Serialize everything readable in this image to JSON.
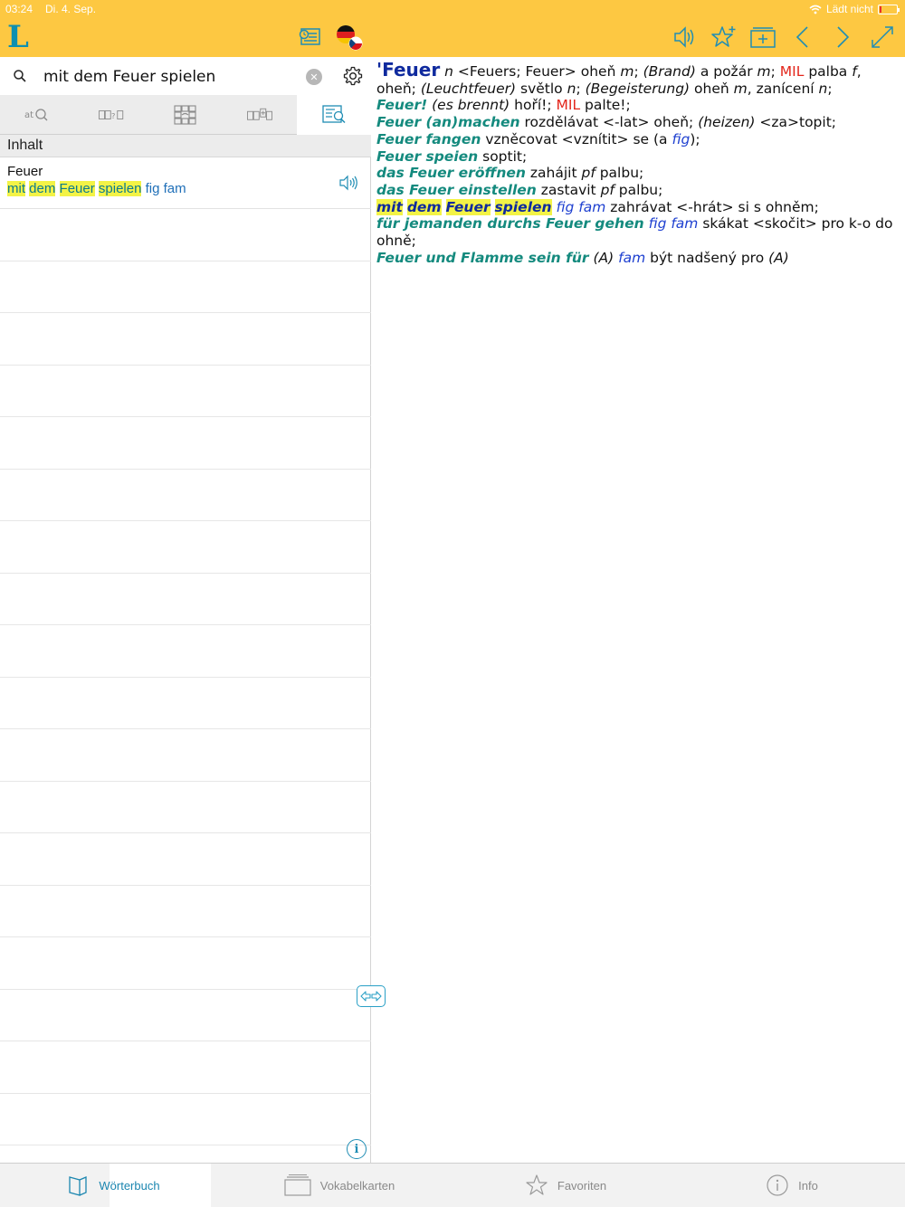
{
  "status": {
    "time": "03:24",
    "date": "Di. 4. Sep.",
    "battery_text": "Lädt nicht"
  },
  "toolbar": {
    "logo": "L",
    "icons": [
      "history-icon",
      "flag-de-cz-icon",
      "speaker-icon",
      "add-favorite-icon",
      "add-flashcard-icon",
      "back-icon",
      "forward-icon",
      "fullscreen-icon"
    ],
    "accent": "#fdc842",
    "icon_color": "#1f8db4"
  },
  "search": {
    "value": "mit dem Feuer spielen",
    "placeholder": ""
  },
  "modes": [
    {
      "name": "mode-fulltext",
      "label": "at"
    },
    {
      "name": "mode-wildcard",
      "label": "?"
    },
    {
      "name": "mode-crossword",
      "label": ""
    },
    {
      "name": "mode-conjugation",
      "label": ""
    },
    {
      "name": "mode-content",
      "label": ""
    }
  ],
  "results_header": "Inhalt",
  "results": [
    {
      "head": "Feuer",
      "phrase": {
        "w1": "mit",
        "w2": "dem",
        "w3": "Feuer",
        "w4": "spielen",
        "labels": "fig fam"
      }
    }
  ],
  "entry": {
    "lemma": "'Feuer",
    "l1": {
      "a": "n",
      "b": "<Feuers; Feuer> oheň",
      "c": "m",
      "d": ";",
      "e": "(Brand)",
      "f": "a požár",
      "g": "m",
      "h": ";",
      "mil": "MIL",
      "i": "palba",
      "j": "f",
      "k": ","
    },
    "l2": {
      "a": "oheň;",
      "b": "(Leuchtfeuer)",
      "c": "světlo",
      "d": "n",
      "e": ";",
      "f": "(Begeisterung)",
      "g": "oheň",
      "h": "m",
      "i": ", zanícení",
      "j": "n",
      "k": ";"
    },
    "l3": {
      "de": "Feuer!",
      "b": "(es brennt)",
      "c": "hoří!;",
      "mil": "MIL",
      "d": "palte!;"
    },
    "l4": {
      "de": "Feuer (an)machen",
      "b": "rozdělávat <-lat> oheň;",
      "c": "(heizen)",
      "d": "<za>topit;"
    },
    "l5": {
      "de": "Feuer fangen",
      "b": "vzněcovat <vznítit> se (a",
      "fig": "fig",
      "c": ");"
    },
    "l6": {
      "de": "Feuer speien",
      "b": "soptit;"
    },
    "l7": {
      "de": "das Feuer eröffnen",
      "b": "zahájit",
      "pf": "pf",
      "c": "palbu;"
    },
    "l8": {
      "de": "das Feuer einstellen",
      "b": "zastavit",
      "pf": "pf",
      "c": "palbu;"
    },
    "l9": {
      "w1": "mit",
      "w2": "dem",
      "w3": "Feuer",
      "w4": "spielen",
      "lbl": "fig fam",
      "b": "zahrávat <-hrát> si s ohněm;"
    },
    "l10": {
      "de": "für jemanden durchs Feuer gehen",
      "lbl": "fig fam",
      "b": "skákat <skočit> pro k-o do"
    },
    "l11": {
      "a": "ohně;"
    },
    "l12": {
      "de": "Feuer und Flamme sein für",
      "b": "(A)",
      "lbl": "fam",
      "c": "být nadšený pro",
      "d": "(A)"
    }
  },
  "tabs": [
    {
      "name": "tab-woerterbuch",
      "label": "Wörterbuch",
      "icon": "book-icon",
      "active": true
    },
    {
      "name": "tab-vokabelkarten",
      "label": "Vokabelkarten",
      "icon": "flashcards-icon",
      "active": false
    },
    {
      "name": "tab-favoriten",
      "label": "Favoriten",
      "icon": "star-icon",
      "active": false
    },
    {
      "name": "tab-info",
      "label": "Info",
      "icon": "info-icon",
      "active": false
    }
  ]
}
